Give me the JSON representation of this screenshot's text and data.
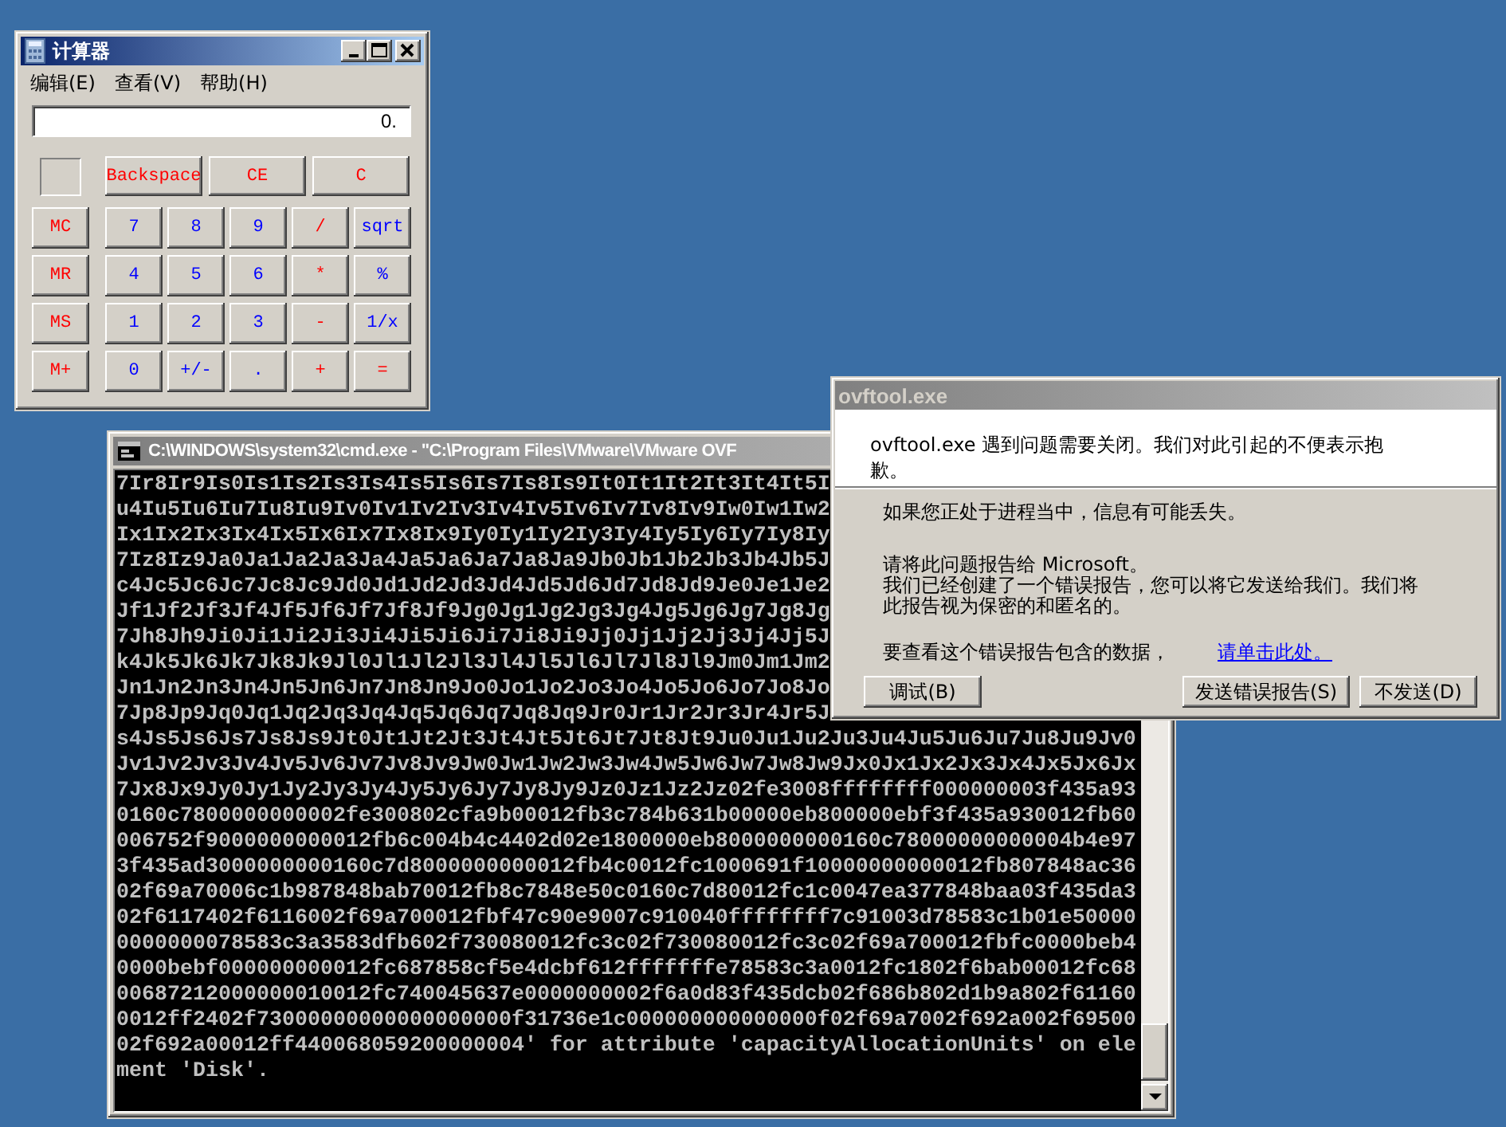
{
  "calculator": {
    "title": "计算器",
    "menu": [
      "编辑(E)",
      "查看(V)",
      "帮助(H)"
    ],
    "display": "0.",
    "control_keys": [
      {
        "label": "Backspace",
        "color": "#ff0000"
      },
      {
        "label": "CE",
        "color": "#ff0000"
      },
      {
        "label": "C",
        "color": "#ff0000"
      }
    ],
    "memory_keys": [
      {
        "label": "MC",
        "color": "#ff0000"
      },
      {
        "label": "MR",
        "color": "#ff0000"
      },
      {
        "label": "MS",
        "color": "#ff0000"
      },
      {
        "label": "M+",
        "color": "#ff0000"
      }
    ],
    "keypad_rows": [
      [
        {
          "label": "7",
          "color": "#0000ff"
        },
        {
          "label": "8",
          "color": "#0000ff"
        },
        {
          "label": "9",
          "color": "#0000ff"
        },
        {
          "label": "/",
          "color": "#ff0000"
        },
        {
          "label": "sqrt",
          "color": "#0000ff"
        }
      ],
      [
        {
          "label": "4",
          "color": "#0000ff"
        },
        {
          "label": "5",
          "color": "#0000ff"
        },
        {
          "label": "6",
          "color": "#0000ff"
        },
        {
          "label": "*",
          "color": "#ff0000"
        },
        {
          "label": "%",
          "color": "#0000ff"
        }
      ],
      [
        {
          "label": "1",
          "color": "#0000ff"
        },
        {
          "label": "2",
          "color": "#0000ff"
        },
        {
          "label": "3",
          "color": "#0000ff"
        },
        {
          "label": "-",
          "color": "#ff0000"
        },
        {
          "label": "1/x",
          "color": "#0000ff"
        }
      ],
      [
        {
          "label": "0",
          "color": "#0000ff"
        },
        {
          "label": "+/-",
          "color": "#0000ff"
        },
        {
          "label": ".",
          "color": "#0000ff"
        },
        {
          "label": "+",
          "color": "#ff0000"
        },
        {
          "label": "=",
          "color": "#ff0000"
        }
      ]
    ]
  },
  "console": {
    "title": "C:\\WINDOWS\\system32\\cmd.exe - \"C:\\Program Files\\VMware\\VMware OVF",
    "lines": [
      "7Ir8Ir9Is0Is1Is2Is3Is4Is5Is6Is7Is8Is9It0It1It2It3It4It5I",
      "u4Iu5Iu6Iu7Iu8Iu9Iv0Iv1Iv2Iv3Iv4Iv5Iv6Iv7Iv8Iv9Iw0Iw1Iw2",
      "Ix1Ix2Ix3Ix4Ix5Ix6Ix7Ix8Ix9Iy0Iy1Iy2Iy3Iy4Iy5Iy6Iy7Iy8Iy",
      "7Iz8Iz9Ja0Ja1Ja2Ja3Ja4Ja5Ja6Ja7Ja8Ja9Jb0Jb1Jb2Jb3Jb4Jb5J",
      "c4Jc5Jc6Jc7Jc8Jc9Jd0Jd1Jd2Jd3Jd4Jd5Jd6Jd7Jd8Jd9Je0Je1Je2",
      "Jf1Jf2Jf3Jf4Jf5Jf6Jf7Jf8Jf9Jg0Jg1Jg2Jg3Jg4Jg5Jg6Jg7Jg8Jg",
      "7Jh8Jh9Ji0Ji1Ji2Ji3Ji4Ji5Ji6Ji7Ji8Ji9Jj0Jj1Jj2Jj3Jj4Jj5J",
      "k4Jk5Jk6Jk7Jk8Jk9Jl0Jl1Jl2Jl3Jl4Jl5Jl6Jl7Jl8Jl9Jm0Jm1Jm2",
      "Jn1Jn2Jn3Jn4Jn5Jn6Jn7Jn8Jn9Jo0Jo1Jo2Jo3Jo4Jo5Jo6Jo7Jo8Jo",
      "7Jp8Jp9Jq0Jq1Jq2Jq3Jq4Jq5Jq6Jq7Jq8Jq9Jr0Jr1Jr2Jr3Jr4Jr5J",
      "s4Js5Js6Js7Js8Js9Jt0Jt1Jt2Jt3Jt4Jt5Jt6Jt7Jt8Jt9Ju0Ju1Ju2Ju3Ju4Ju5Ju6Ju7Ju8Ju9Jv0",
      "Jv1Jv2Jv3Jv4Jv5Jv6Jv7Jv8Jv9Jw0Jw1Jw2Jw3Jw4Jw5Jw6Jw7Jw8Jw9Jx0Jx1Jx2Jx3Jx4Jx5Jx6Jx",
      "7Jx8Jx9Jy0Jy1Jy2Jy3Jy4Jy5Jy6Jy7Jy8Jy9Jz0Jz1Jz2Jz02fe3008ffffffff000000003f435a93",
      "0160c7800000000002fe300802cfa9b00012fb3c784b631b00000eb800000ebf3f435a930012fb60",
      "006752f9000000000012fb6c004b4c4402d02e1800000eb8000000000160c78000000000004b4e97",
      "3f435ad3000000000160c7d8000000000012fb4c0012fc1000691f10000000000012fb807848ac36",
      "02f69a70006c1b987848bab70012fb8c7848e50c0160c7d80012fc1c0047ea377848baa03f435da3",
      "02f6117402f6116002f69a700012fbf47c90e9007c910040ffffffff7c91003d78583c1b01e50000",
      "0000000078583c3a3583dfb602f730080012fc3c02f730080012fc3c02f69a700012fbfc0000beb4",
      "0000bebf000000000012fc687858cf5e4dcbf612fffffffe78583c3a0012fc1802f6bab00012fc68",
      "00687212000000010012fc740045637e0000000002f6a0d83f435dcb02f686b802d1b9a802f61160",
      "0012ff2402f73000000000000000000f31736e1c000000000000000f02f69a7002f692a002f69500",
      "02f692a00012ff440068059200000004' for attribute 'capacityAllocationUnits' on ele",
      "ment 'Disk'."
    ]
  },
  "error_dialog": {
    "title": "ovftool.exe",
    "headline": "ovftool.exe 遇到问题需要关闭。我们对此引起的不便表示抱歉。",
    "notice": "如果您正处于进程当中，信息有可能丢失。",
    "report_request": "请将此问题报告给 Microsoft。",
    "report_detail": "我们已经创建了一个错误报告，您可以将它发送给我们。我们将此报告视为保密的和匿名的。",
    "data_prompt": "要查看这个错误报告包含的数据，",
    "data_link": "请单击此处。",
    "buttons": [
      "调试(B)",
      "发送错误报告(S)",
      "不发送(D)"
    ]
  }
}
